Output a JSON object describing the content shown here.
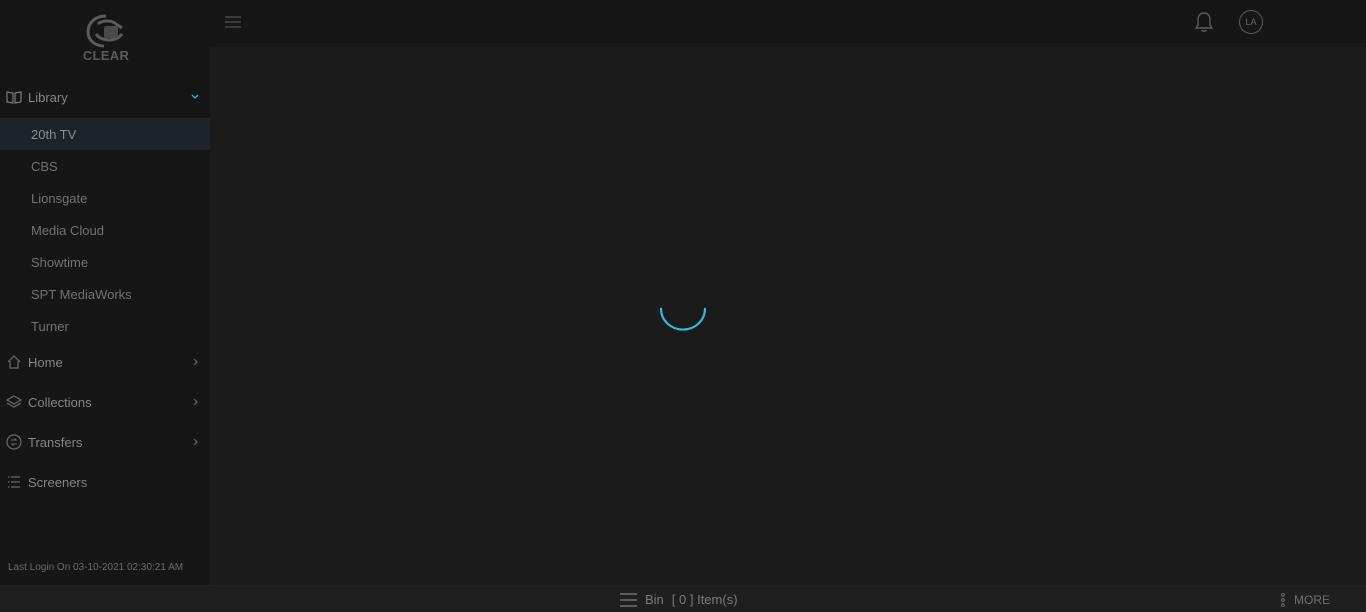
{
  "brand": {
    "logo_text": "CLEAR"
  },
  "sidebar": {
    "library": {
      "label": "Library",
      "items": [
        {
          "label": "20th TV",
          "active": true
        },
        {
          "label": "CBS"
        },
        {
          "label": "Lionsgate"
        },
        {
          "label": "Media Cloud"
        },
        {
          "label": "Showtime"
        },
        {
          "label": "SPT MediaWorks"
        },
        {
          "label": "Turner"
        }
      ]
    },
    "home": {
      "label": "Home"
    },
    "collections": {
      "label": "Collections"
    },
    "transfers": {
      "label": "Transfers"
    },
    "screeners": {
      "label": "Screeners"
    },
    "last_login": "Last Login On 03-10-2021 02:30:21 AM"
  },
  "header": {
    "avatar_initials": "LA"
  },
  "bottom_bar": {
    "bin_label": "Bin",
    "bin_count_text": "[ 0 ] Item(s)",
    "more_label": "MORE"
  },
  "colors": {
    "accent": "#3fb5d6",
    "sidebar_bg": "#161616",
    "main_bg": "#1b1b1b",
    "active_item_bg": "#1c2329"
  },
  "icons": {
    "library": "book-open-icon",
    "home": "home-icon",
    "collections": "layers-icon",
    "transfers": "transfer-icon",
    "screeners": "list-icon",
    "hamburger": "menu-icon",
    "bell": "bell-icon",
    "bin": "menu-lines-icon",
    "more": "vertical-dots-icon"
  }
}
